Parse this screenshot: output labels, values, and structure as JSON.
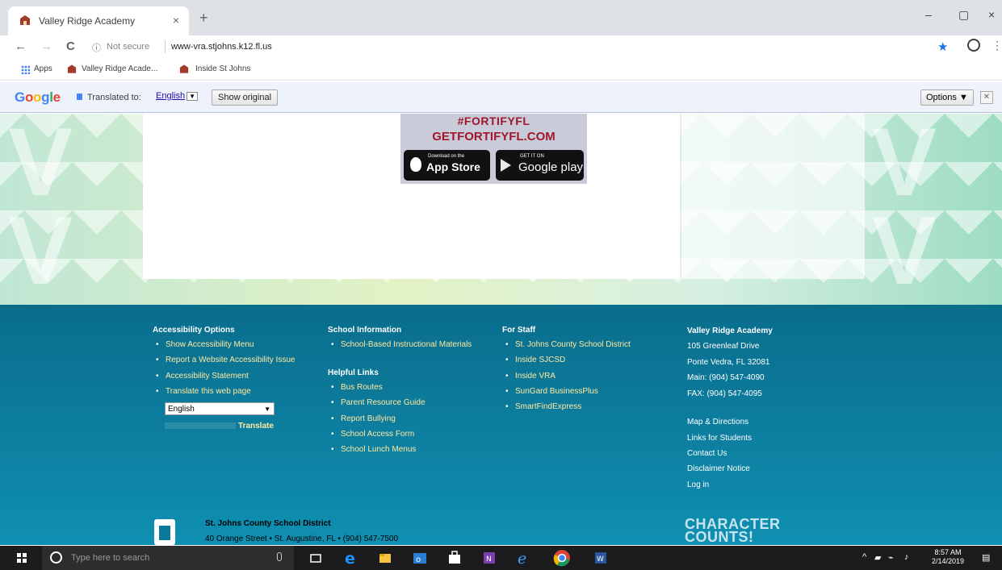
{
  "browser": {
    "tab_title": "Valley Ridge Academy",
    "tab_close": "×",
    "new_tab": "+",
    "security_label": "Not secure",
    "url": "www-vra.stjohns.k12.fl.us",
    "minimize": "–",
    "maximize": "▢",
    "close": "×",
    "menu": "⋮",
    "back": "←",
    "forward": "→",
    "reload": "C",
    "bookmarks": {
      "apps": "Apps",
      "item1": "Valley Ridge Acade...",
      "item2": "Inside St Johns"
    }
  },
  "translate_bar": {
    "google_letters": [
      "G",
      "o",
      "o",
      "g",
      "l",
      "e"
    ],
    "translated_to": "Translated to:",
    "language": "English",
    "show_original": "Show original",
    "options": "Options ▼",
    "close": "✕"
  },
  "promo": {
    "line1": "#FORTIFYFL",
    "line2": "GETFORTIFYFL.COM",
    "appstore_small": "Download on the",
    "appstore_big": "App Store",
    "googleplay_small": "GET IT ON",
    "googleplay_big": "Google play"
  },
  "footer": {
    "accessibility": {
      "heading": "Accessibility Options",
      "links": [
        "Show Accessibility Menu",
        "Report a Website Accessibility Issue",
        "Accessibility Statement",
        "Translate this web page"
      ],
      "dropdown_value": "English",
      "translate_link": "Translate"
    },
    "school_info": {
      "heading": "School Information",
      "links": [
        "School-Based Instructional Materials"
      ]
    },
    "helpful": {
      "heading": "Helpful Links",
      "links": [
        "Bus Routes",
        "Parent Resource Guide",
        "Report Bullying",
        "School Access Form",
        "School Lunch Menus"
      ]
    },
    "staff": {
      "heading": "For Staff",
      "links": [
        "St. Johns County School District",
        "Inside SJCSD",
        "Inside VRA",
        "SunGard BusinessPlus",
        "SmartFindExpress"
      ]
    },
    "school": {
      "name": "Valley Ridge Academy",
      "address1": "105 Greenleaf Drive",
      "address2": "Ponte Vedra, FL 32081",
      "main": "Main: (904) 547-4090",
      "fax": "FAX: (904) 547-4095",
      "links": [
        "Map & Directions",
        "Links for Students",
        "Contact Us",
        "Disclaimer Notice",
        "Log in"
      ]
    },
    "district": {
      "name": "St. Johns County School District",
      "address": "40 Orange Street  •  St. Augustine, FL  •  (904) 547-7500"
    },
    "character_counts": [
      "CHARACTER",
      "COUNTS!"
    ]
  },
  "taskbar": {
    "search_placeholder": "Type here to search",
    "time": "8:57 AM",
    "date": "2/14/2019"
  }
}
